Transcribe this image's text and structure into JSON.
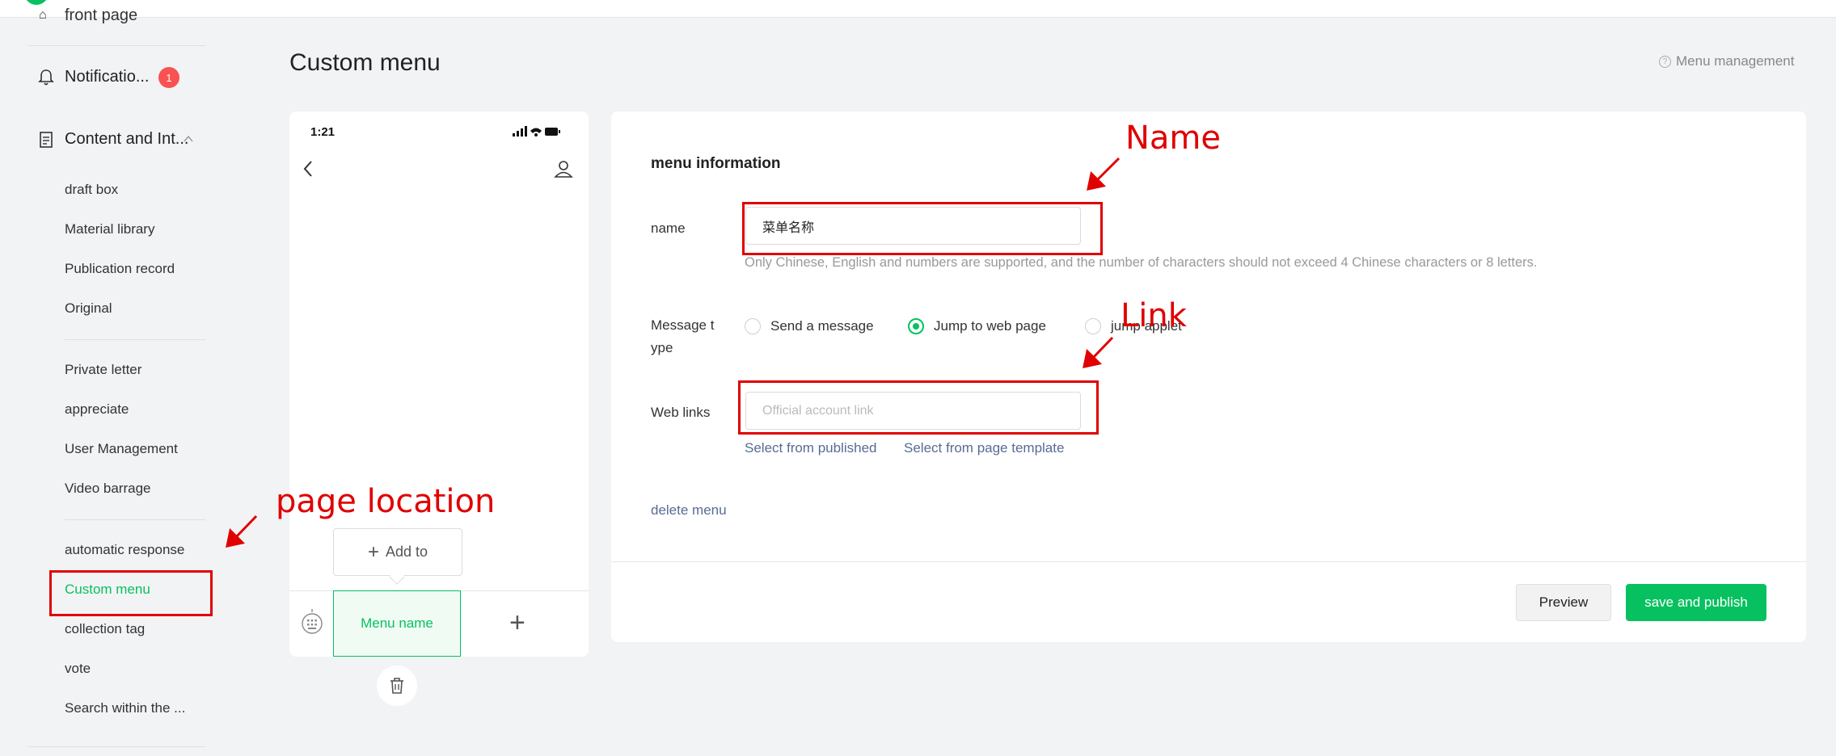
{
  "sidebar": {
    "home_label": "front page",
    "notifications_label": "Notificatio...",
    "notifications_badge": "1",
    "content_label": "Content and Int...",
    "group1": [
      "draft box",
      "Material library",
      "Publication record",
      "Original"
    ],
    "group2": [
      "Private letter",
      "appreciate",
      "User Management",
      "Video barrage"
    ],
    "group3": [
      "automatic response",
      "Custom menu",
      "collection tag",
      "vote",
      "Search within the ..."
    ],
    "active_item": "Custom menu"
  },
  "header": {
    "title": "Custom menu",
    "help_label": "Menu management"
  },
  "phone": {
    "time": "1:21",
    "add_label": "Add to",
    "menu_name": "Menu name"
  },
  "form": {
    "heading": "menu information",
    "name_label": "name",
    "name_value": "菜单名称",
    "name_hint": "Only Chinese, English and numbers are supported, and the number of characters should not exceed 4 Chinese characters or 8 letters.",
    "message_type_label_line1": "Message t",
    "message_type_label_line2": "ype",
    "radio_options": [
      "Send a message",
      "Jump to web page",
      "jump applet"
    ],
    "selected_option": "Jump to web page",
    "web_links_label": "Web links",
    "web_links_placeholder": "Official account link",
    "select_published": "Select from published",
    "select_template": "Select from page template",
    "delete_menu": "delete menu",
    "preview_button": "Preview",
    "publish_button": "save and publish"
  },
  "annotations": {
    "name": "Name",
    "link": "Link",
    "page_location": "page location",
    "color": "#e00000"
  },
  "theme": {
    "accent": "#07c160",
    "link": "#576b95",
    "badge": "#fa5151"
  }
}
